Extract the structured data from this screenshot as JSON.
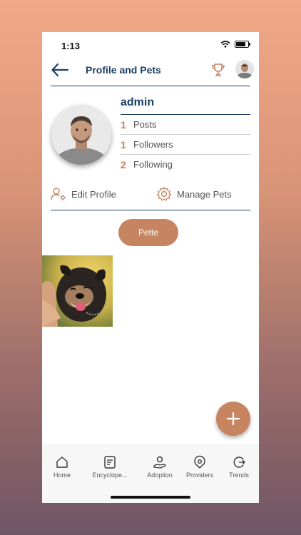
{
  "status_bar": {
    "time": "1:13"
  },
  "header": {
    "title": "Profile and Pets"
  },
  "profile": {
    "username": "admin",
    "stats": [
      {
        "count": "1",
        "label": "Posts"
      },
      {
        "count": "1",
        "label": "Followers"
      },
      {
        "count": "2",
        "label": "Following"
      }
    ]
  },
  "actions": {
    "edit_profile": "Edit Profile",
    "manage_pets": "Manage Pets"
  },
  "pets": {
    "selected_pet": "Pette"
  },
  "bottom_nav": {
    "items": [
      {
        "label": "Home",
        "icon": "home-icon"
      },
      {
        "label": "Encyclope...",
        "icon": "encyclopedia-icon"
      },
      {
        "label": "Adoption",
        "icon": "adoption-icon"
      },
      {
        "label": "Providers",
        "icon": "providers-icon"
      },
      {
        "label": "Trends",
        "icon": "trends-icon"
      }
    ]
  },
  "colors": {
    "accent": "#c68461",
    "primary": "#1d3f66"
  }
}
